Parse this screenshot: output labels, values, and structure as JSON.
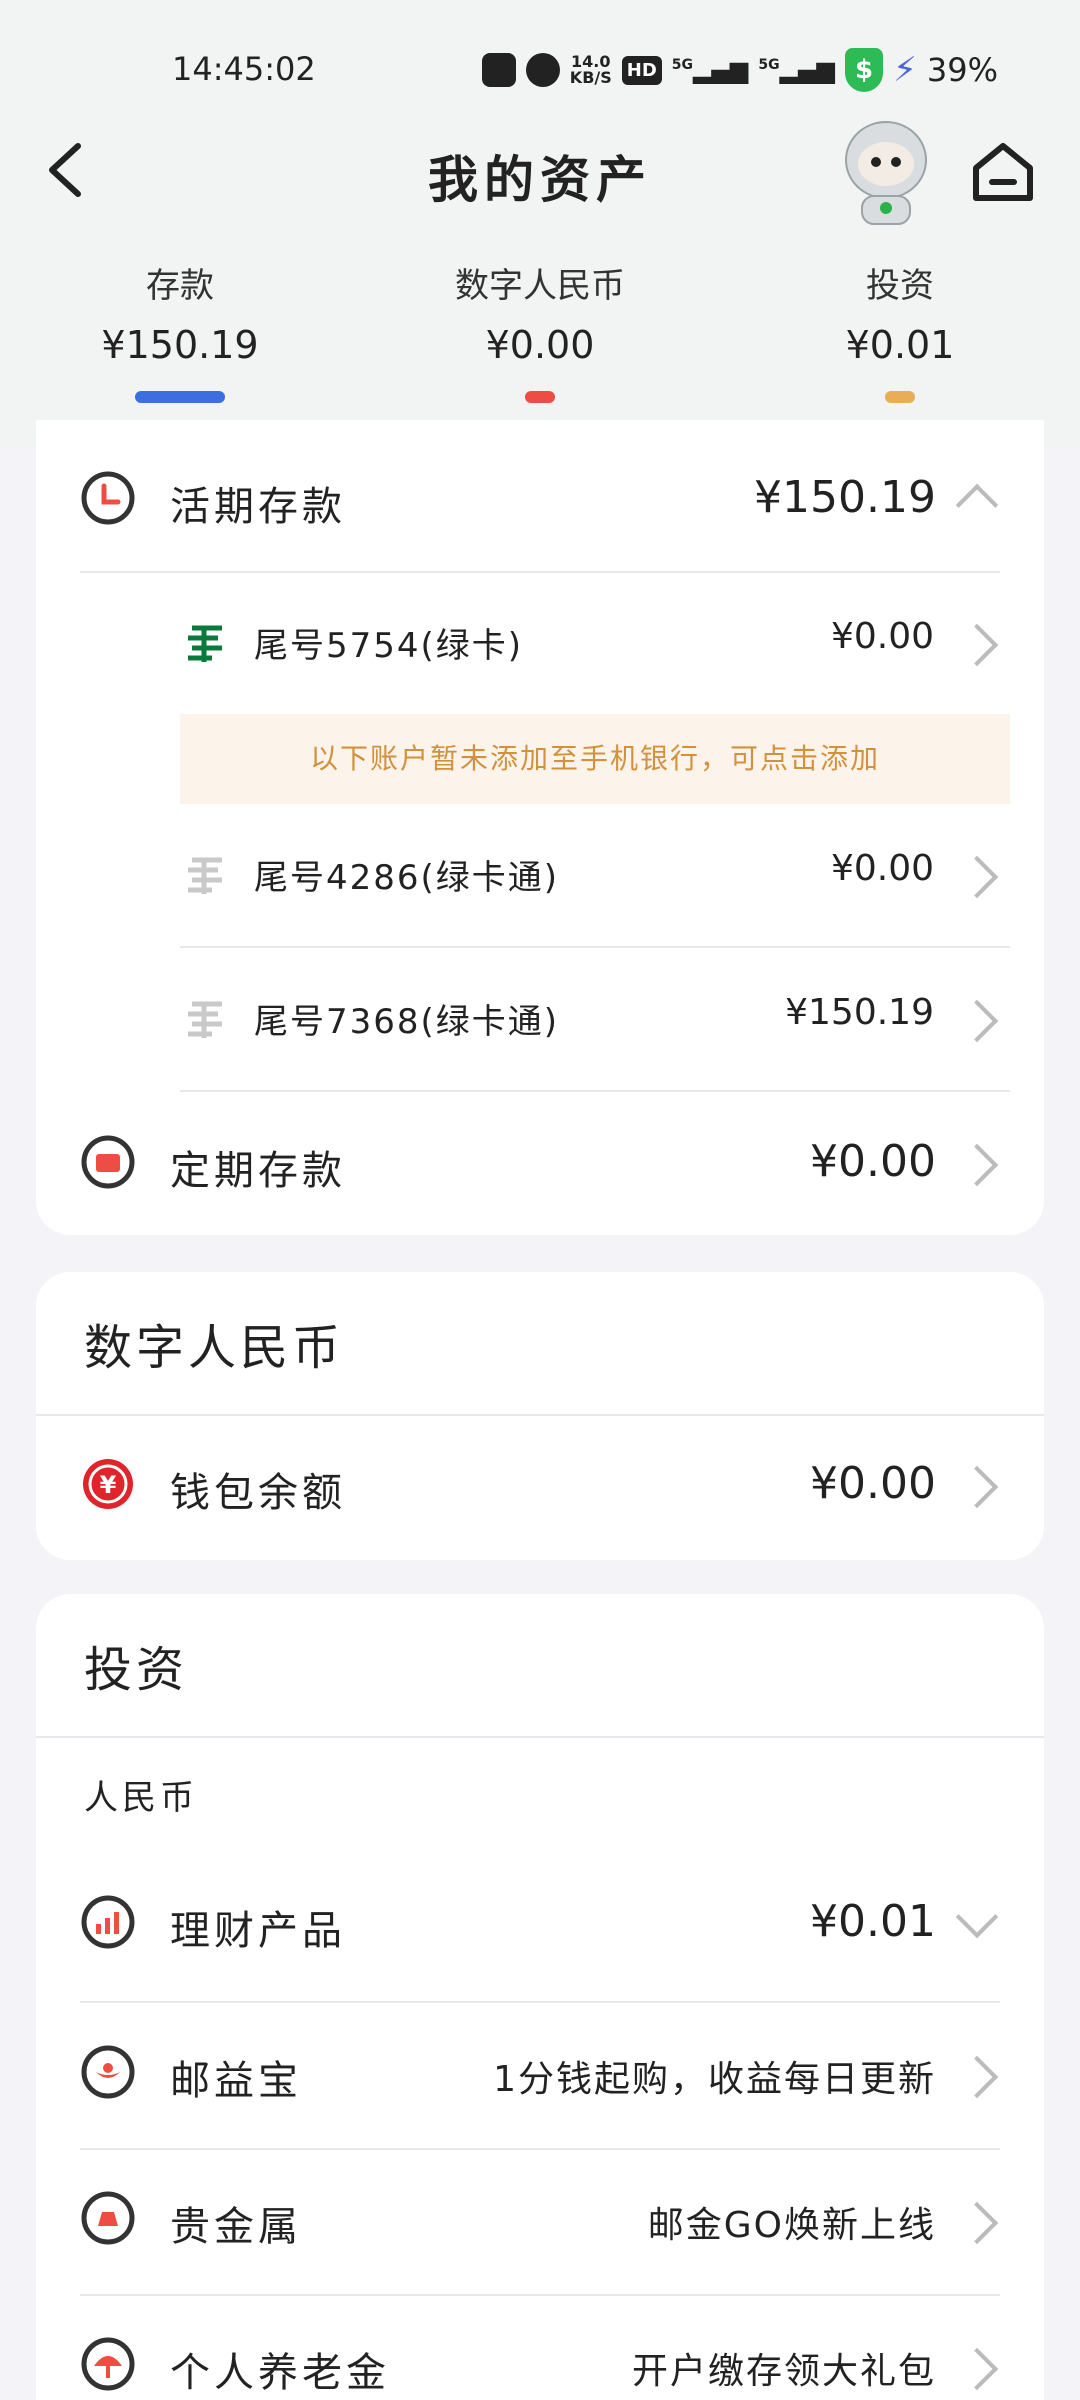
{
  "status_bar": {
    "time": "14:45:02",
    "net_speed": "14.0",
    "net_unit": "KB/S",
    "hd": "HD",
    "sim1": "5G",
    "sim2": "5G",
    "battery": "39%"
  },
  "header": {
    "title": "我的资产"
  },
  "tabs": [
    {
      "label": "存款",
      "amount": "¥150.19",
      "color": "#3b6fe0"
    },
    {
      "label": "数字人民币",
      "amount": "¥0.00",
      "color": "#ee4d44"
    },
    {
      "label": "投资",
      "amount": "¥0.01",
      "color": "#e8ad55"
    }
  ],
  "deposits": {
    "current": {
      "label": "活期存款",
      "value": "¥150.19"
    },
    "accounts": [
      {
        "label": "尾号5754(绿卡)",
        "value": "¥0.00"
      },
      {
        "label": "尾号4286(绿卡通)",
        "value": "¥0.00"
      },
      {
        "label": "尾号7368(绿卡通)",
        "value": "¥150.19"
      }
    ],
    "notice": "以下账户暂未添加至手机银行，可点击添加",
    "fixed": {
      "label": "定期存款",
      "value": "¥0.00"
    }
  },
  "digital_rmb": {
    "title": "数字人民币",
    "wallet": {
      "label": "钱包余额",
      "value": "¥0.00"
    }
  },
  "investment": {
    "title": "投资",
    "currency": "人民币",
    "items": [
      {
        "label": "理财产品",
        "value": "¥0.01"
      },
      {
        "label": "邮益宝",
        "value": "1分钱起购，收益每日更新"
      },
      {
        "label": "贵金属",
        "value": "邮金GO焕新上线"
      },
      {
        "label": "个人养老金",
        "value": "开户缴存领大礼包"
      }
    ]
  }
}
